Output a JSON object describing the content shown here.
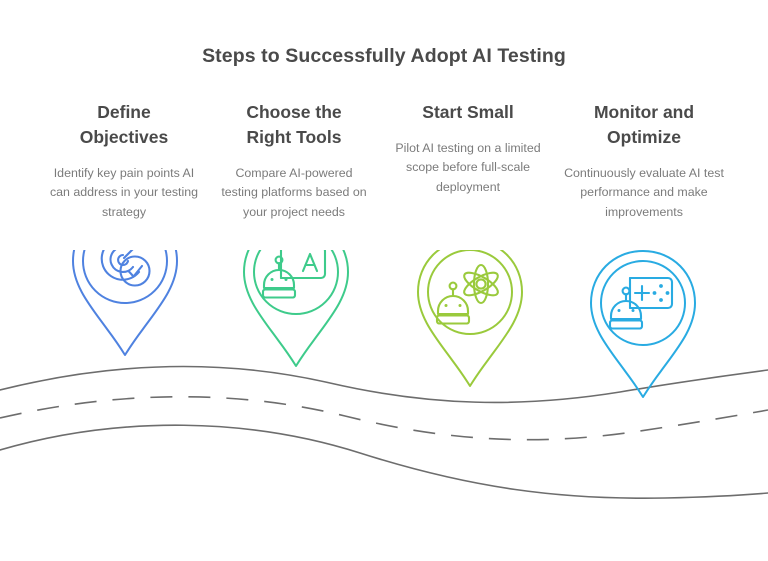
{
  "title": "Steps to Successfully Adopt AI Testing",
  "title_color": "#4a4a4a",
  "background_color": "#ffffff",
  "road": {
    "line_color": "#6d6d6d",
    "dash_color": "#6d6d6d"
  },
  "steps": [
    {
      "heading": "Define Objectives",
      "heading_line1": "Define",
      "heading_line2": "Objectives",
      "description": "Identify key pain points AI can address in your testing strategy",
      "color": "#4f82e0",
      "icon": "target-arrow-check-icon"
    },
    {
      "heading": "Choose the Right Tools",
      "heading_line1": "Choose the",
      "heading_line2": "Right Tools",
      "description": "Compare AI-powered testing platforms based on your project needs",
      "color": "#3ecb8b",
      "icon": "robot-screen-letter-a-icon"
    },
    {
      "heading": "Start Small",
      "heading_line1": "Start Small",
      "heading_line2": "",
      "description": "Pilot AI testing on a limited scope before full-scale deployment",
      "color": "#9aca3c",
      "icon": "robot-atom-icon"
    },
    {
      "heading": "Monitor and Optimize",
      "heading_line1": "Monitor and",
      "heading_line2": "Optimize",
      "description": "Continuously evaluate AI test performance and make improvements",
      "color": "#29abe2",
      "icon": "robot-dashboard-screen-icon"
    }
  ]
}
